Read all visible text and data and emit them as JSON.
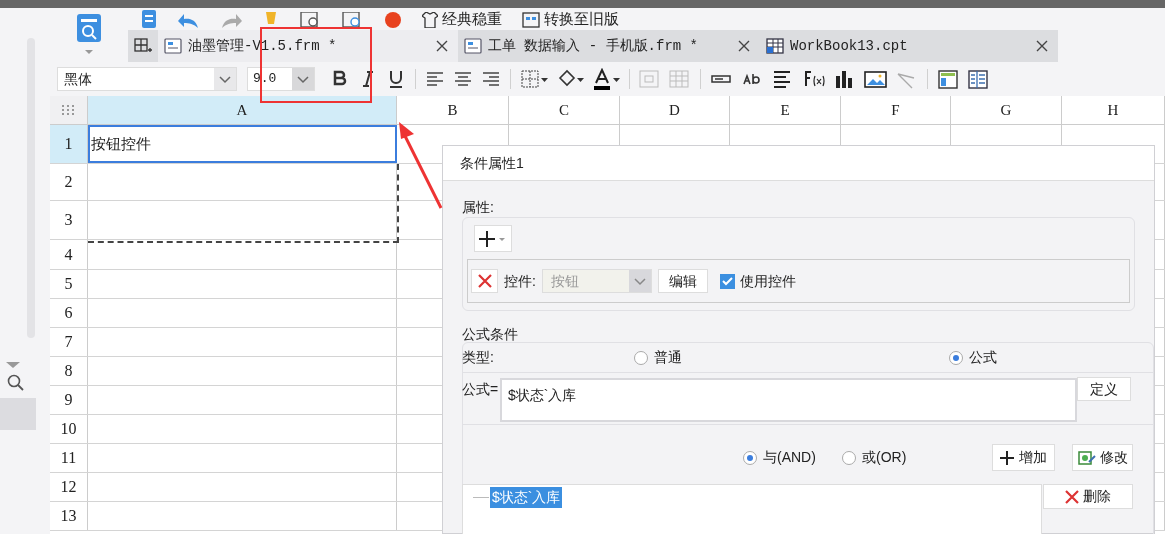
{
  "toolbar": {
    "buttons": [
      {
        "label": "经典稳重"
      },
      {
        "label": "转换至旧版"
      }
    ]
  },
  "tabs": [
    {
      "label": "油墨管理-V1.5.frm *",
      "selected": true,
      "kind": "form"
    },
    {
      "label": "工单 数据输入 - 手机版.frm *",
      "selected": false,
      "kind": "form"
    },
    {
      "label": "WorkBook13.cpt",
      "selected": false,
      "kind": "workbook"
    }
  ],
  "format_bar": {
    "font": "黑体",
    "size": "9.0"
  },
  "sheet": {
    "columns": [
      {
        "label": "A",
        "selected": true
      },
      {
        "label": "B",
        "selected": false
      },
      {
        "label": "C",
        "selected": false
      },
      {
        "label": "D",
        "selected": false
      },
      {
        "label": "E",
        "selected": false
      },
      {
        "label": "F",
        "selected": false
      },
      {
        "label": "G",
        "selected": false
      },
      {
        "label": "H",
        "selected": false
      }
    ],
    "rows": [
      {
        "label": "1",
        "selected": true,
        "cell": "按钮控件"
      },
      {
        "label": "2",
        "selected": false
      },
      {
        "label": "3",
        "selected": false
      },
      {
        "label": "4",
        "selected": false
      },
      {
        "label": "5",
        "selected": false
      },
      {
        "label": "6",
        "selected": false
      },
      {
        "label": "7",
        "selected": false
      },
      {
        "label": "8",
        "selected": false
      },
      {
        "label": "9",
        "selected": false
      },
      {
        "label": "10",
        "selected": false
      },
      {
        "label": "11",
        "selected": false
      },
      {
        "label": "12",
        "selected": false
      },
      {
        "label": "13",
        "selected": false
      }
    ]
  },
  "dialog": {
    "title": "条件属性1",
    "properties": {
      "heading": "属性:",
      "control_label": "控件:",
      "control_value": "按钮",
      "control_disabled": true,
      "edit_button": "编辑",
      "use_control": {
        "label": "使用控件",
        "checked": true
      }
    },
    "formula_condition": {
      "heading": "公式条件",
      "type_label": "类型:",
      "types": [
        {
          "label": "普通",
          "selected": false
        },
        {
          "label": "公式",
          "selected": true
        }
      ],
      "formula_label": "公式=",
      "formula": "$状态`入库",
      "define_button": "定义",
      "joins": [
        {
          "label": "与(AND)",
          "selected": true
        },
        {
          "label": "或(OR)",
          "selected": false
        }
      ],
      "add_button": "增加",
      "modify_button": "修改",
      "conditions": [
        {
          "label": "$状态`入库",
          "selected": true
        }
      ],
      "delete_button": "删除"
    }
  }
}
